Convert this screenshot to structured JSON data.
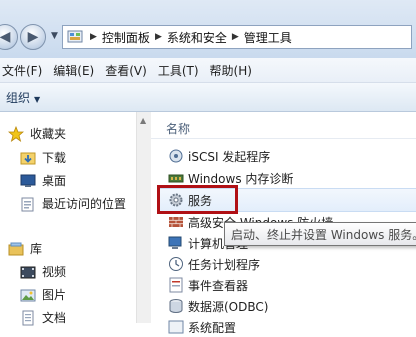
{
  "address_bar": {
    "crumbs": [
      "控制面板",
      "系统和安全",
      "管理工具"
    ]
  },
  "menu": [
    "文件(F)",
    "编辑(E)",
    "查看(V)",
    "工具(T)",
    "帮助(H)"
  ],
  "command_bar": {
    "organize": "组织"
  },
  "nav_pane": {
    "favorites": {
      "label": "收藏夹",
      "items": [
        "下载",
        "桌面",
        "最近访问的位置"
      ]
    },
    "libraries": {
      "label": "库",
      "items": [
        "视频",
        "图片",
        "文档"
      ]
    }
  },
  "content": {
    "column_name": "名称",
    "items": [
      "iSCSI 发起程序",
      "Windows 内存诊断",
      "服务",
      "高级安全 Windows 防火墙",
      "计算机管理",
      "任务计划程序",
      "事件查看器",
      "数据源(ODBC)",
      "系统配置"
    ]
  },
  "tooltip": "启动、终止并设置 Windows 服务。",
  "colors": {
    "highlight_border": "#b01015",
    "address_bar_bg": "#c9daee"
  }
}
